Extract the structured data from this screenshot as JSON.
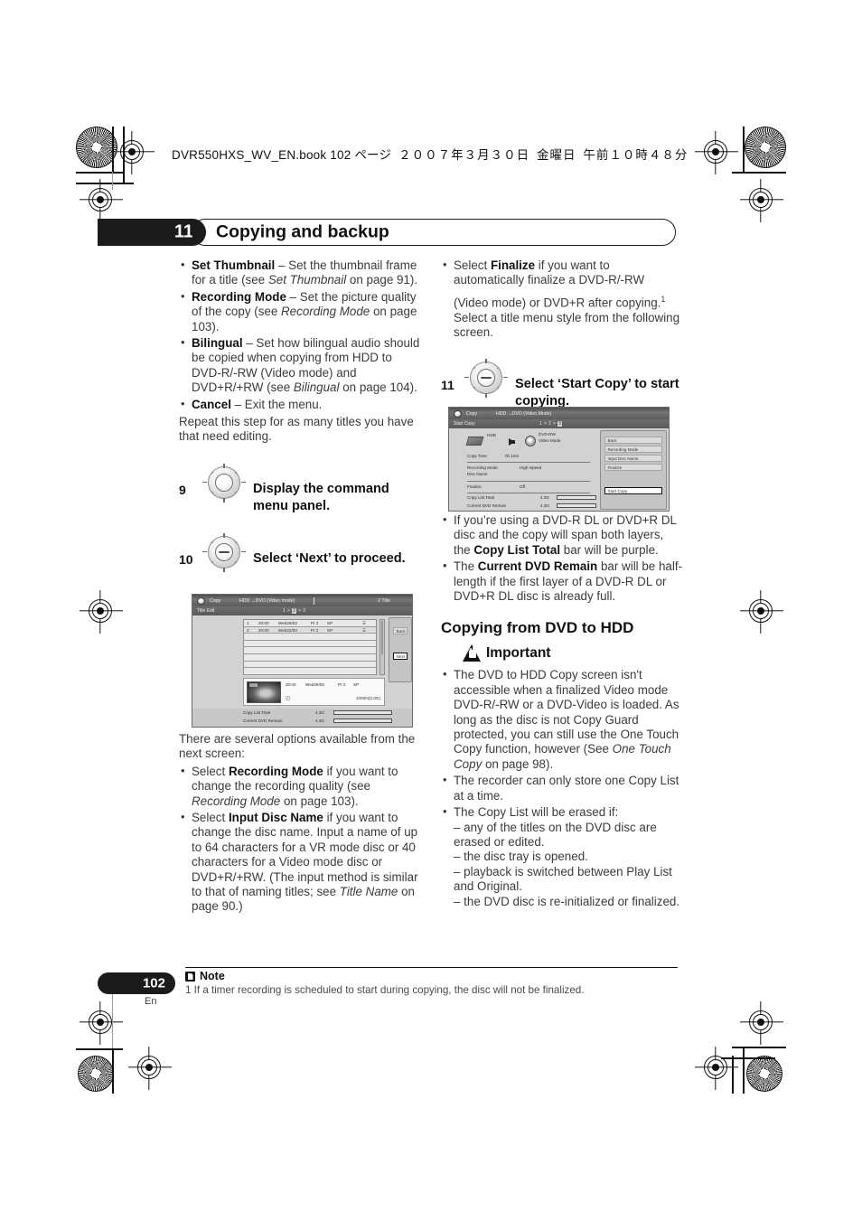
{
  "running_header": {
    "file": "DVR550HXS_WV_EN.book",
    "page_note": "102 ページ",
    "date": "２００７年３月３０日",
    "weekday": "金曜日",
    "time": "午前１０時４８分"
  },
  "chapter": {
    "number": "11",
    "title": "Copying and backup"
  },
  "left_column": {
    "bullets": [
      {
        "term": "Set Thumbnail",
        "rest": " – Set the thumbnail frame for a title (see ",
        "italic": "Set Thumbnail",
        "tail": " on page 91)."
      },
      {
        "term": "Recording Mode",
        "rest": " – Set the picture quality of the copy (see ",
        "italic": "Recording Mode",
        "tail": " on page 103)."
      },
      {
        "term": "Bilingual",
        "rest": " – Set how bilingual audio should be copied when copying from HDD to DVD-R/-RW (Video mode) and DVD+R/+RW (see ",
        "italic": "Bilingual",
        "tail": " on page 104)."
      },
      {
        "term": "Cancel",
        "rest": " – Exit the menu.",
        "italic": "",
        "tail": ""
      }
    ],
    "paragraph": "Repeat this step for as many titles you have that need editing.",
    "step9": {
      "number": "9",
      "text": "Display the command menu panel.",
      "icon": "dpad-enter-icon"
    },
    "step10": {
      "number": "10",
      "text": "Select ‘Next’ to proceed.",
      "icon": "dpad-updown-icon"
    },
    "after_figure": "There are several options available from the next screen:",
    "bullets2": [
      {
        "lead": "Select ",
        "term": "Recording Mode",
        "rest": " if you want to change the recording quality (see ",
        "italic": "Recording Mode",
        "tail": " on page 103)."
      },
      {
        "lead": "Select ",
        "term": "Input Disc Name",
        "rest": " if you want to change the disc name. Input a name of up to 64 characters for a VR mode disc or 40 characters for a Video mode disc or DVD+R/+RW. (The input method is similar to that of naming titles; see ",
        "italic": "Title Name",
        "tail": " on page 90.)"
      }
    ]
  },
  "figure1": {
    "header": {
      "app": "Copy",
      "mode": "HDD →DVD (Video mode)",
      "count": "2 Title"
    },
    "subheader": {
      "label": "Title Edit",
      "steps_prefix": "1 > ",
      "steps_current": "2",
      "steps_suffix": " > 3"
    },
    "rows": [
      {
        "num": "1",
        "time": "20:00",
        "date": "Wed29/03",
        "prog": "Pr 2",
        "mode": "SP"
      },
      {
        "num": "2",
        "time": "20:00",
        "date": "Wed22/03",
        "prog": "Pr 2",
        "mode": "SP"
      }
    ],
    "buttons": [
      {
        "label": "Back",
        "selected": false
      },
      {
        "label": "Next",
        "selected": true
      }
    ],
    "detail": {
      "time": "20:00",
      "date": "Wed29/03",
      "prog": "Pr 2",
      "mode": "SP",
      "size": "1h00m(2.0G)"
    },
    "totals": [
      {
        "label": "Copy List Total",
        "value": "4.3G"
      },
      {
        "label": "Current DVD Remain",
        "value": "4.3G"
      }
    ]
  },
  "right_column": {
    "bullet_finalize": {
      "lead": "Select ",
      "term": "Finalize",
      "rest": " if you want to automatically finalize a DVD-R/-RW",
      "line2": "(Video mode) or DVD+R after copying.",
      "footnote_marker": "1",
      "line3": "Select a title menu style from the following screen."
    },
    "step11": {
      "number": "11",
      "text": "Select ‘Start Copy’ to start copying.",
      "icon": "dpad-updown-icon"
    },
    "bullets": [
      {
        "pre": "If you’re using a DVD-R DL or DVD+R DL disc and the copy will span both layers, the ",
        "term": "Copy List Total",
        "post": " bar will be purple."
      },
      {
        "pre": "The ",
        "term": "Current DVD Remain",
        "post": " bar will be half-length if the first layer of a DVD-R DL or DVD+R DL disc is already full."
      }
    ],
    "section_heading": "Copying from DVD to HDD",
    "important_label": "Important",
    "important_icon": "warning-hand-icon",
    "important_bullets": [
      {
        "pre": "The DVD to HDD Copy screen isn't accessible when a finalized Video mode DVD-R/-RW or a DVD-Video is loaded. As long as the disc is not Copy Guard protected, you can still use the One Touch Copy function, however (See ",
        "italic": "One Touch Copy",
        "post": " on page 98)."
      },
      {
        "pre": "The recorder can only store one Copy List at a time.",
        "italic": "",
        "post": ""
      }
    ],
    "erase_bullet": {
      "lead": "The Copy List will be erased if:",
      "items": [
        "– any of the titles on the DVD disc are erased or edited.",
        "– the disc tray is opened.",
        "– playback is switched between Play List and Original.",
        "– the DVD disc is re-initialized or finalized."
      ]
    }
  },
  "figure2": {
    "header": {
      "app": "Copy",
      "mode": "HDD →DVD (Video Mode)"
    },
    "subheader": {
      "label": "Start Copy",
      "steps_prefix": "1 > 2 > ",
      "steps_current": "3"
    },
    "source_label": "HDD",
    "dest_label_1": "DVD-RW",
    "dest_label_2": "Video Mode",
    "fields": [
      {
        "label": "Copy Time",
        "value": "0h 16m"
      },
      {
        "label": "Recording Mode",
        "value": "High-Speed"
      },
      {
        "label": "Disc Name",
        "value": ""
      },
      {
        "label": "Finalize",
        "value": "Off"
      }
    ],
    "menu": [
      {
        "label": "Back",
        "selected": false
      },
      {
        "label": "Recording Mode",
        "selected": false
      },
      {
        "label": "Input Disc Name",
        "selected": false
      },
      {
        "label": "Finalize",
        "selected": false
      },
      {
        "label": "Start Copy",
        "selected": true
      }
    ],
    "totals": [
      {
        "label": "Copy List Total",
        "value": "4.3G"
      },
      {
        "label": "Current DVD Remain",
        "value": "4.3G"
      }
    ]
  },
  "footer": {
    "page_number": "102",
    "language": "En",
    "note_label": "Note",
    "note_text": "1 If a timer recording is scheduled to start during copying, the disc will not be finalized."
  }
}
